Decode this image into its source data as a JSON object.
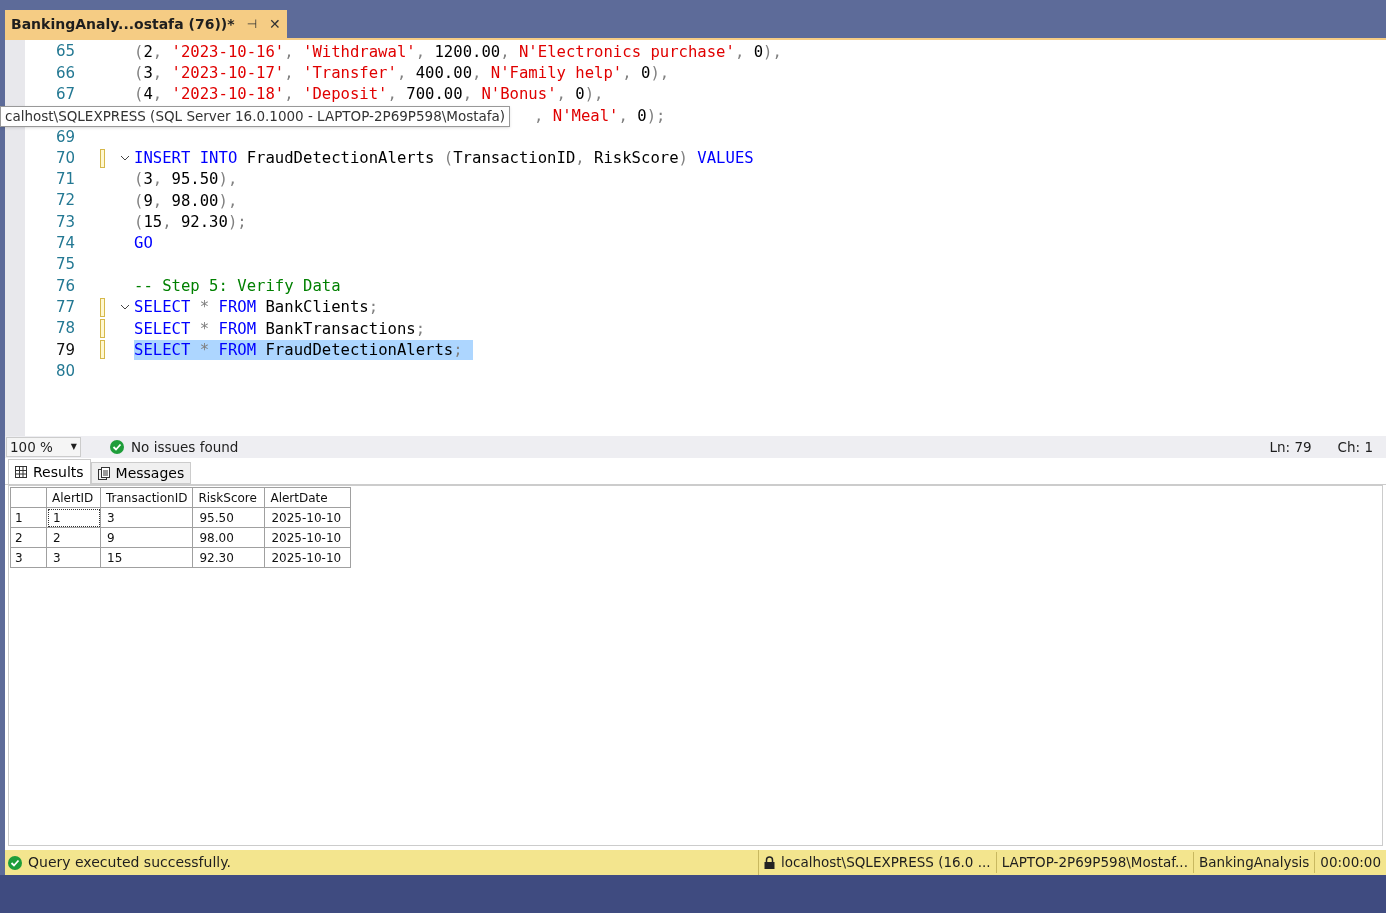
{
  "tab": {
    "title": "BankingAnaly...ostafa (76))*",
    "pin": "⊣",
    "close": "✕",
    "active": true
  },
  "tooltip": "calhost\\SQLEXPRESS (SQL Server 16.0.1000 - LAPTOP-2P69P598\\Mostafa)",
  "code_lines": [
    {
      "number": "65",
      "selected": false,
      "tokens": [
        {
          "kind": "punct",
          "t": "("
        },
        {
          "kind": "plain",
          "t": "2"
        },
        {
          "kind": "punct",
          "t": ", "
        },
        {
          "kind": "string",
          "t": "'2023-10-16'"
        },
        {
          "kind": "punct",
          "t": ", "
        },
        {
          "kind": "string",
          "t": "'Withdrawal'"
        },
        {
          "kind": "punct",
          "t": ", "
        },
        {
          "kind": "plain",
          "t": "1200.00"
        },
        {
          "kind": "punct",
          "t": ", "
        },
        {
          "kind": "string",
          "t": "N'Electronics purchase'"
        },
        {
          "kind": "punct",
          "t": ", "
        },
        {
          "kind": "plain",
          "t": "0"
        },
        {
          "kind": "punct",
          "t": "),"
        }
      ]
    },
    {
      "number": "66",
      "selected": false,
      "tokens": [
        {
          "kind": "punct",
          "t": "("
        },
        {
          "kind": "plain",
          "t": "3"
        },
        {
          "kind": "punct",
          "t": ", "
        },
        {
          "kind": "string",
          "t": "'2023-10-17'"
        },
        {
          "kind": "punct",
          "t": ", "
        },
        {
          "kind": "string",
          "t": "'Transfer'"
        },
        {
          "kind": "punct",
          "t": ", "
        },
        {
          "kind": "plain",
          "t": "400.00"
        },
        {
          "kind": "punct",
          "t": ", "
        },
        {
          "kind": "string",
          "t": "N'Family help'"
        },
        {
          "kind": "punct",
          "t": ", "
        },
        {
          "kind": "plain",
          "t": "0"
        },
        {
          "kind": "punct",
          "t": "),"
        }
      ]
    },
    {
      "number": "67",
      "selected": false,
      "tokens": [
        {
          "kind": "punct",
          "t": "("
        },
        {
          "kind": "plain",
          "t": "4"
        },
        {
          "kind": "punct",
          "t": ", "
        },
        {
          "kind": "string",
          "t": "'2023-10-18'"
        },
        {
          "kind": "punct",
          "t": ", "
        },
        {
          "kind": "string",
          "t": "'Deposit'"
        },
        {
          "kind": "punct",
          "t": ", "
        },
        {
          "kind": "plain",
          "t": "700.00"
        },
        {
          "kind": "punct",
          "t": ", "
        },
        {
          "kind": "string",
          "t": "N'Bonus'"
        },
        {
          "kind": "punct",
          "t": ", "
        },
        {
          "kind": "plain",
          "t": "0"
        },
        {
          "kind": "punct",
          "t": "),"
        }
      ]
    },
    {
      "selected": false,
      "tokens": [
        {
          "kind": "punct",
          "t": ", "
        },
        {
          "kind": "string",
          "t": "N'Meal'"
        },
        {
          "kind": "punct",
          "t": ", "
        },
        {
          "kind": "plain",
          "t": "0"
        },
        {
          "kind": "punct",
          "t": ");"
        }
      ]
    },
    {
      "number": "69",
      "selected": false
    },
    {
      "number": "70",
      "selected": false,
      "fold": true,
      "changed": true,
      "tokens": [
        {
          "kind": "keyword",
          "t": "INSERT "
        },
        {
          "kind": "keyword",
          "t": "INTO"
        },
        {
          "kind": "plain",
          "t": " FraudDetectionAlerts "
        },
        {
          "kind": "punct",
          "t": "("
        },
        {
          "kind": "plain",
          "t": "TransactionID"
        },
        {
          "kind": "punct",
          "t": ", "
        },
        {
          "kind": "plain",
          "t": "RiskScore"
        },
        {
          "kind": "punct",
          "t": ") "
        },
        {
          "kind": "keyword",
          "t": "VALUES"
        }
      ]
    },
    {
      "number": "71",
      "selected": false,
      "tokens": [
        {
          "kind": "punct",
          "t": "("
        },
        {
          "kind": "plain",
          "t": "3"
        },
        {
          "kind": "punct",
          "t": ", "
        },
        {
          "kind": "plain",
          "t": "95.50"
        },
        {
          "kind": "punct",
          "t": "),"
        }
      ]
    },
    {
      "number": "72",
      "selected": false,
      "tokens": [
        {
          "kind": "punct",
          "t": "("
        },
        {
          "kind": "plain",
          "t": "9"
        },
        {
          "kind": "punct",
          "t": ", "
        },
        {
          "kind": "plain",
          "t": "98.00"
        },
        {
          "kind": "punct",
          "t": "),"
        }
      ]
    },
    {
      "number": "73",
      "selected": false,
      "tokens": [
        {
          "kind": "punct",
          "t": "("
        },
        {
          "kind": "plain",
          "t": "15"
        },
        {
          "kind": "punct",
          "t": ", "
        },
        {
          "kind": "plain",
          "t": "92.30"
        },
        {
          "kind": "punct",
          "t": ");"
        }
      ]
    },
    {
      "number": "74",
      "selected": false,
      "tokens": [
        {
          "kind": "keyword",
          "t": "GO"
        }
      ]
    },
    {
      "number": "75",
      "selected": false
    },
    {
      "number": "76",
      "selected": false,
      "tokens": [
        {
          "kind": "comment",
          "t": "-- Step 5: Verify Data"
        }
      ]
    },
    {
      "number": "77",
      "selected": false,
      "fold": true,
      "changed": true,
      "tokens": [
        {
          "kind": "keyword",
          "t": "SELECT"
        },
        {
          "kind": "punct",
          "t": " * "
        },
        {
          "kind": "keyword",
          "t": "FROM"
        },
        {
          "kind": "plain",
          "t": " BankClients"
        },
        {
          "kind": "punct",
          "t": ";"
        }
      ]
    },
    {
      "number": "78",
      "selected": false,
      "changed": true,
      "tokens": [
        {
          "kind": "keyword",
          "t": "SELECT"
        },
        {
          "kind": "punct",
          "t": " * "
        },
        {
          "kind": "keyword",
          "t": "FROM"
        },
        {
          "kind": "plain",
          "t": " BankTransactions"
        },
        {
          "kind": "punct",
          "t": ";"
        }
      ]
    },
    {
      "number": "79",
      "selected": true,
      "changed": true,
      "tokens": [
        {
          "kind": "keyword",
          "t": "SELECT"
        },
        {
          "kind": "punct",
          "t": " * "
        },
        {
          "kind": "keyword",
          "t": "FROM"
        },
        {
          "kind": "plain",
          "t": " FraudDetectionAlerts"
        },
        {
          "kind": "punct",
          "t": ";"
        }
      ]
    },
    {
      "number": "80",
      "selected": false
    }
  ],
  "editor_status": {
    "zoom": "100 %",
    "zoom_caret": "▼",
    "issues": "No issues found",
    "line": "Ln: 79",
    "char": "Ch: 1"
  },
  "result_tabs": [
    {
      "label": "Results",
      "selected": true
    },
    {
      "label": "Messages",
      "selected": false
    }
  ],
  "table": {
    "columns": [
      "AlertID",
      "TransactionID",
      "RiskScore",
      "AlertDate"
    ],
    "rows": [
      {
        "number": "1",
        "cells": [
          "1",
          "3",
          "95.50",
          "2025-10-10"
        ]
      },
      {
        "number": "2",
        "cells": [
          "2",
          "9",
          "98.00",
          "2025-10-10"
        ]
      },
      {
        "number": "3",
        "cells": [
          "3",
          "15",
          "92.30",
          "2025-10-10"
        ]
      }
    ]
  },
  "status_bar": {
    "message": "Query executed successfully.",
    "server": "localhost\\SQLEXPRESS (16.0 ...",
    "user": "LAPTOP-2P69P598\\Mostaf...",
    "database": "BankingAnalysis",
    "time": "00:00:00"
  }
}
